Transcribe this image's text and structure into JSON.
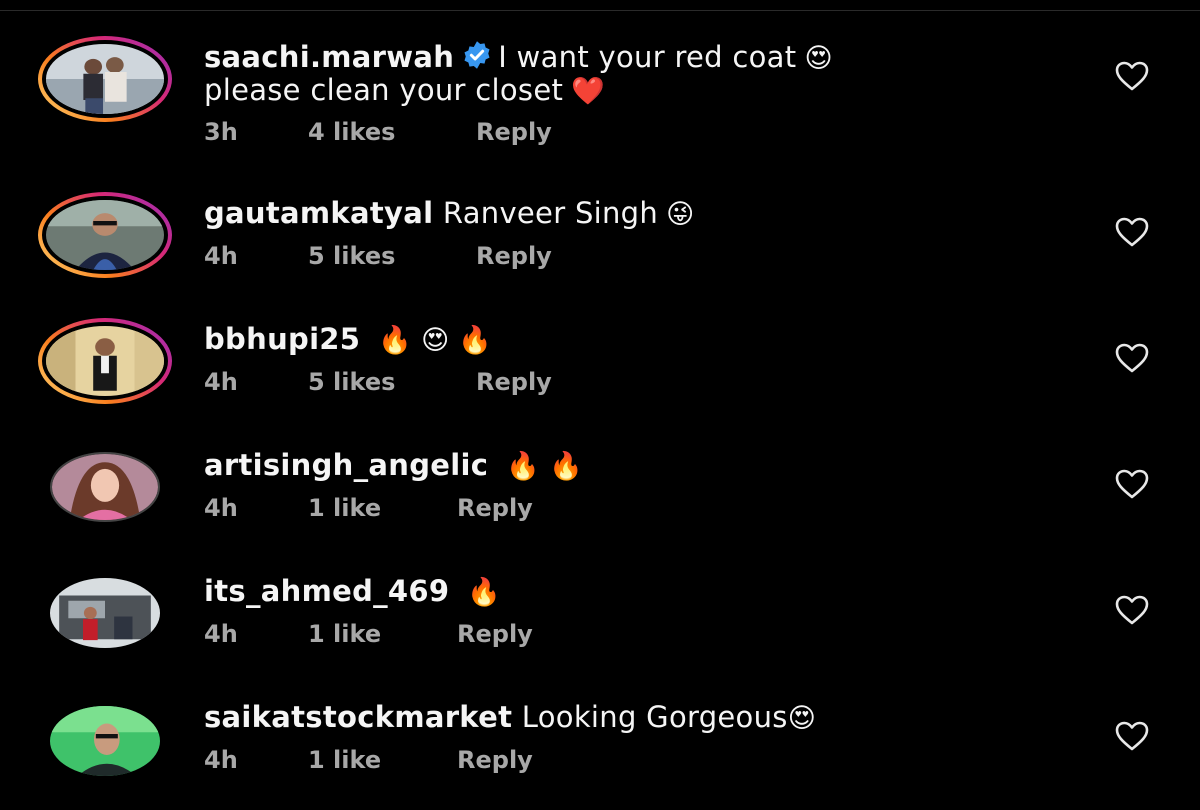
{
  "comments": [
    {
      "username": "saachi.marwah",
      "verified": true,
      "text_line1": "I want your red coat",
      "emoji_line1": "😍",
      "text_line2": "please clean your closet",
      "emoji_line2": "❤️",
      "time": "3h",
      "likes": "4 likes",
      "reply": "Reply",
      "has_story": true
    },
    {
      "username": "gautamkatyal",
      "text": "Ranveer Singh",
      "emoji": "😜",
      "time": "4h",
      "likes": "5 likes",
      "reply": "Reply",
      "has_story": true
    },
    {
      "username": "bbhupi25",
      "emoji": "🔥 😍 🔥",
      "time": "4h",
      "likes": "5 likes",
      "reply": "Reply",
      "has_story": true
    },
    {
      "username": "artisingh_angelic",
      "emoji": "🔥 🔥",
      "time": "4h",
      "likes": "1 like",
      "reply": "Reply",
      "has_story": false
    },
    {
      "username": "its_ahmed_469",
      "emoji": "🔥",
      "time": "4h",
      "likes": "1 like",
      "reply": "Reply",
      "has_story": false
    },
    {
      "username": "saikatstockmarket",
      "text": "Looking Gorgeous",
      "emoji": "😍",
      "time": "4h",
      "likes": "1 like",
      "reply": "Reply",
      "has_story": false
    }
  ],
  "colors": {
    "background": "#000000",
    "text": "#f5f5f5",
    "meta": "#a8a8a8",
    "verified": "#3897f0",
    "story_ring": [
      "#feda75",
      "#fa7e1e",
      "#d62976",
      "#962fbf"
    ]
  },
  "icons": {
    "like": "heart-outline-icon",
    "verified": "verified-badge-icon"
  }
}
